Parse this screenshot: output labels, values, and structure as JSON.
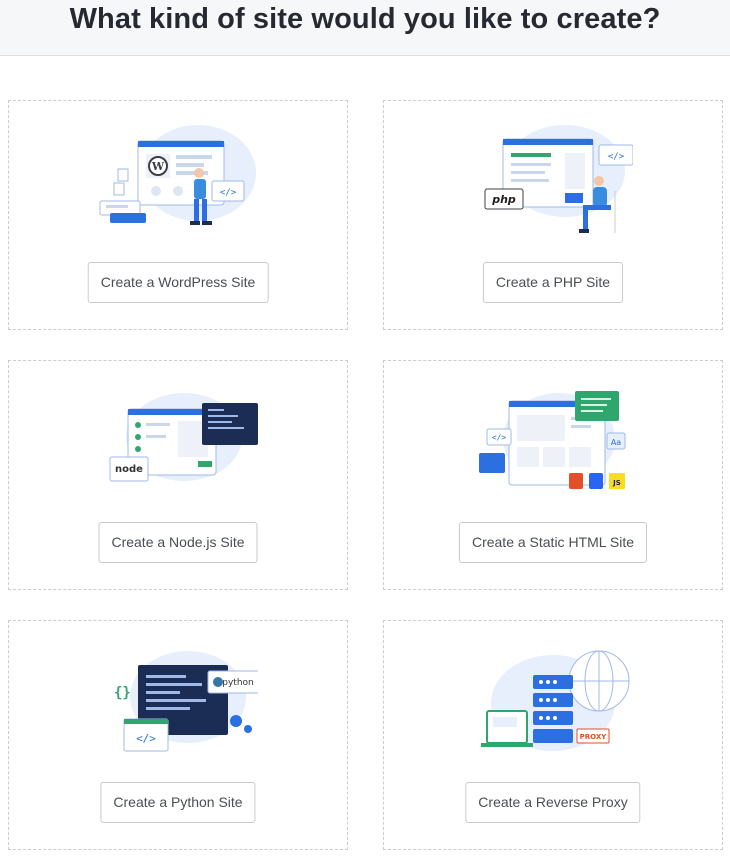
{
  "page": {
    "title": "What kind of site would you like to create?"
  },
  "cards": [
    {
      "label": "Create a WordPress Site",
      "icon": "wordpress-illustration"
    },
    {
      "label": "Create a PHP Site",
      "icon": "php-illustration",
      "badge": "php"
    },
    {
      "label": "Create a Node.js Site",
      "icon": "nodejs-illustration",
      "badge": "node"
    },
    {
      "label": "Create a Static HTML Site",
      "icon": "static-html-illustration",
      "badges": [
        "Aa",
        "JS"
      ]
    },
    {
      "label": "Create a Python Site",
      "icon": "python-illustration",
      "badge": "python"
    },
    {
      "label": "Create a Reverse Proxy",
      "icon": "reverse-proxy-illustration",
      "badge": "PROXY"
    }
  ],
  "colors": {
    "accent_blue": "#2b6fe0",
    "navy": "#1b2d55",
    "green": "#2fa66d",
    "blob": "#e7effc",
    "header_bg": "#f6f7f9"
  }
}
